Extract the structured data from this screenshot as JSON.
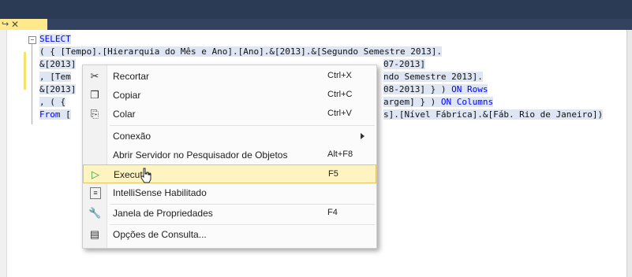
{
  "tab": {
    "pin_icon": "pin-icon",
    "close_icon": "close-icon"
  },
  "code": {
    "line1": "SELECT",
    "line2": "( { [Tempo].[Hierarquia do Mês e Ano].[Ano].&[2013].&[Segundo Semestre 2013].",
    "line3a": "&[2013]",
    "line3b": "07-2013]",
    "line4a": ", [Tem",
    "line4b": "ndo Semestre 2013].",
    "line5a": "&[2013]",
    "line5b": "08-2013] } ) ",
    "line5kw": "ON Rows",
    "line6a": ", ( {",
    "line6b": "argem] } ) ",
    "line6kw": "ON Columns",
    "line7kw": "From",
    "line7a": " [",
    "line7b": "s].[Nível Fábrica].&[Fáb. Rio de Janeiro])"
  },
  "menu": {
    "cut": {
      "label": "Recortar",
      "shortcut": "Ctrl+X"
    },
    "copy": {
      "label": "Copiar",
      "shortcut": "Ctrl+C"
    },
    "paste": {
      "label": "Colar",
      "shortcut": "Ctrl+V"
    },
    "connection": {
      "label": "Conexão"
    },
    "open_server": {
      "label": "Abrir Servidor no Pesquisador de Objetos",
      "shortcut": "Alt+F8"
    },
    "execute": {
      "label": "Executar",
      "shortcut": "F5"
    },
    "intellisense": {
      "label": "IntelliSense Habilitado"
    },
    "properties": {
      "label": "Janela de Propriedades",
      "shortcut": "F4"
    },
    "query_options": {
      "label": "Opções de Consulta..."
    }
  }
}
